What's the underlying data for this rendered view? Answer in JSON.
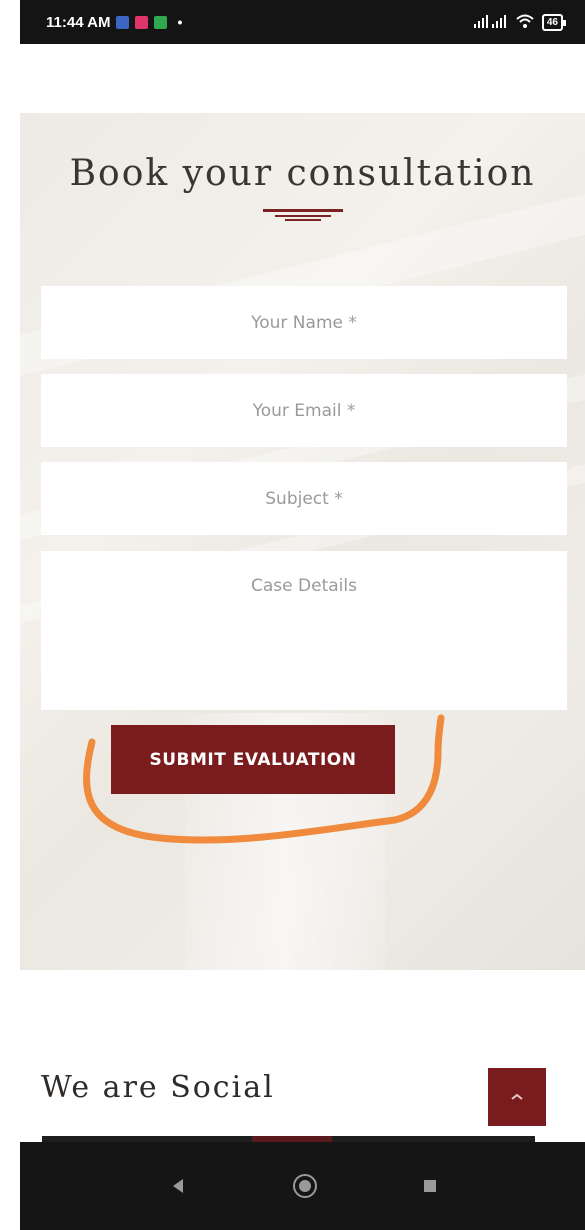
{
  "status_bar": {
    "time": "11:44 AM",
    "notification_icons": [
      "facebook-icon",
      "mail-icon",
      "message-icon"
    ],
    "signal": "..ıl ..ıl",
    "battery": "46"
  },
  "booking": {
    "title": "Book your consultation",
    "fields": {
      "name_placeholder": "Your Name *",
      "email_placeholder": "Your Email *",
      "subject_placeholder": "Subject *",
      "details_placeholder": "Case Details"
    },
    "submit_label": "SUBMIT EVALUATION"
  },
  "social": {
    "heading": "We are Social"
  },
  "colors": {
    "brand": "#7a1c1e",
    "annotation": "#f08a3c"
  },
  "nav": {
    "back_icon": "back-triangle-icon",
    "home_icon": "home-circle-icon",
    "recent_icon": "recent-apps-square-icon"
  }
}
